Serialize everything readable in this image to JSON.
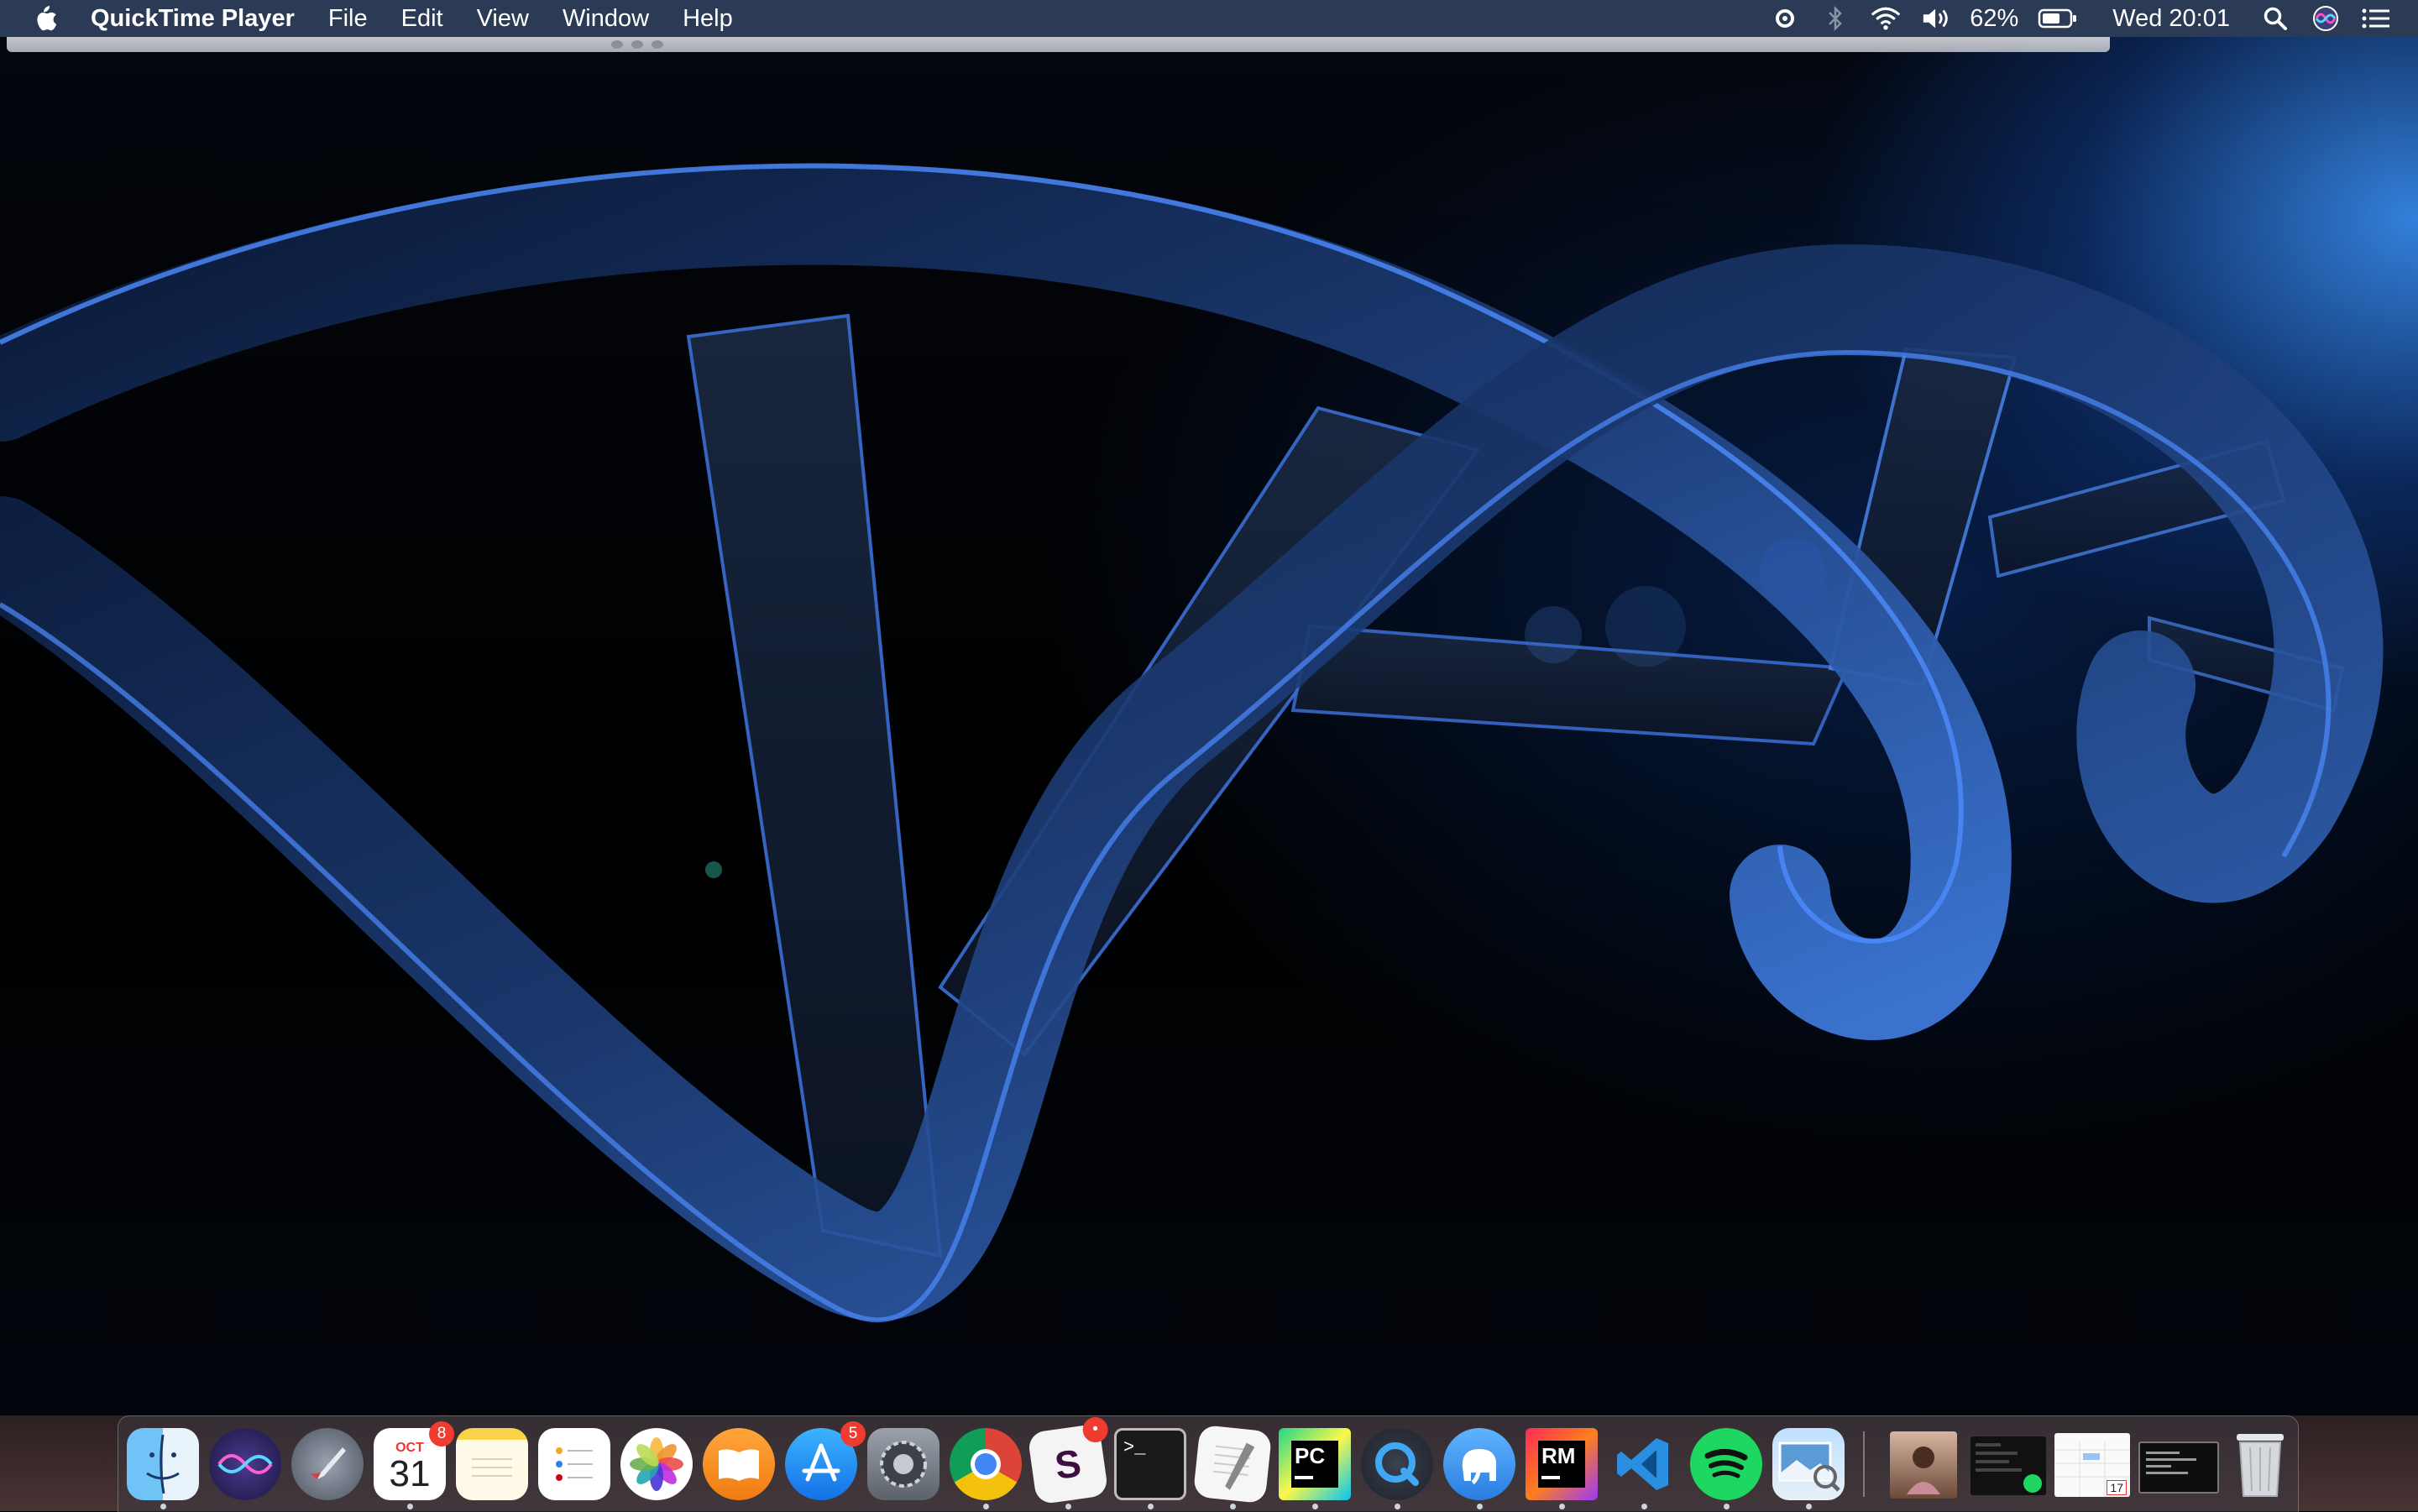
{
  "menubar": {
    "app_name": "QuickTime Player",
    "menus": [
      "File",
      "Edit",
      "View",
      "Window",
      "Help"
    ],
    "status": {
      "battery_percent": "62%",
      "clock": "Wed 20:01"
    },
    "icons": [
      "apple-logo-icon",
      "creative-cloud-icon",
      "bluetooth-icon",
      "wifi-icon",
      "volume-icon",
      "battery-icon",
      "spotlight-search-icon",
      "siri-icon",
      "notification-center-icon"
    ]
  },
  "desktop": {
    "wallpaper": "dna-helix",
    "accent_color": "#3d8bff"
  },
  "dock": {
    "apps": [
      {
        "name": "Finder",
        "icon": "finder-icon",
        "running": true
      },
      {
        "name": "Siri",
        "icon": "siri-icon",
        "running": false
      },
      {
        "name": "Launchpad",
        "icon": "launchpad-icon",
        "running": false
      },
      {
        "name": "Calendar",
        "icon": "calendar-icon",
        "running": true,
        "month": "OCT",
        "day": "31",
        "badge": "8"
      },
      {
        "name": "Notes",
        "icon": "notes-icon",
        "running": false
      },
      {
        "name": "Reminders",
        "icon": "reminders-icon",
        "running": false
      },
      {
        "name": "Photos",
        "icon": "photos-icon",
        "running": false
      },
      {
        "name": "Books",
        "icon": "books-icon",
        "running": false
      },
      {
        "name": "App Store",
        "icon": "app-store-icon",
        "running": false,
        "badge": "5"
      },
      {
        "name": "System Preferences",
        "icon": "system-preferences-icon",
        "running": false
      },
      {
        "name": "Chrome",
        "icon": "chrome-icon",
        "running": true
      },
      {
        "name": "Slack",
        "icon": "slack-icon",
        "running": true,
        "badge": "•"
      },
      {
        "name": "Terminal",
        "icon": "terminal-icon",
        "running": true,
        "label": ">_"
      },
      {
        "name": "TextEdit",
        "icon": "textedit-icon",
        "running": true
      },
      {
        "name": "PyCharm",
        "icon": "pycharm-icon",
        "running": true,
        "label": "PC"
      },
      {
        "name": "QuickTime Player",
        "icon": "quicktime-icon",
        "running": true
      },
      {
        "name": "TablePlus",
        "icon": "elephant-icon",
        "running": true
      },
      {
        "name": "RubyMine",
        "icon": "rubymine-icon",
        "running": true,
        "label": "RM"
      },
      {
        "name": "VS Code",
        "icon": "vscode-icon",
        "running": true
      },
      {
        "name": "Spotify",
        "icon": "spotify-icon",
        "running": true
      },
      {
        "name": "Preview",
        "icon": "preview-icon",
        "running": true
      }
    ],
    "recents": [
      {
        "name": "Photo",
        "icon": "photo-thumbnail-icon"
      },
      {
        "name": "Spotify window",
        "icon": "spotify-window-thumbnail-icon"
      },
      {
        "name": "Calendar window",
        "icon": "calendar-window-thumbnail-icon",
        "day": "17"
      },
      {
        "name": "Terminal window",
        "icon": "terminal-window-thumbnail-icon"
      }
    ],
    "trash": {
      "name": "Trash",
      "icon": "trash-icon"
    }
  }
}
